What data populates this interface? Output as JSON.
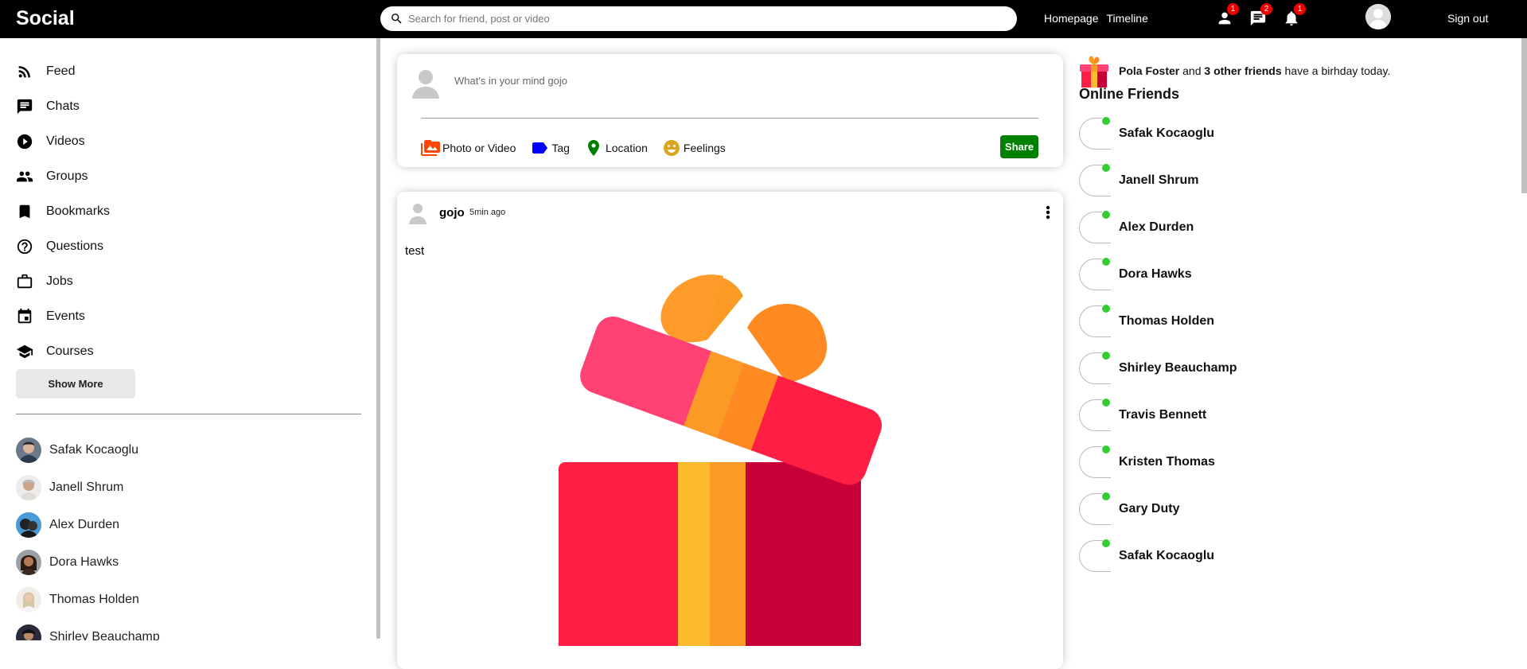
{
  "topbar": {
    "logo": "Social",
    "search_placeholder": "Search for friend, post or video",
    "links": [
      "Homepage",
      "Timeline"
    ],
    "badges": {
      "person": "1",
      "chat": "2",
      "notifications": "1"
    },
    "signout": "Sign out"
  },
  "sidebar": {
    "menu": [
      {
        "label": "Feed",
        "icon": "rss-feed-icon"
      },
      {
        "label": "Chats",
        "icon": "chat-icon"
      },
      {
        "label": "Videos",
        "icon": "play-circle-icon"
      },
      {
        "label": "Groups",
        "icon": "group-icon"
      },
      {
        "label": "Bookmarks",
        "icon": "bookmark-icon"
      },
      {
        "label": "Questions",
        "icon": "help-outline-icon"
      },
      {
        "label": "Jobs",
        "icon": "work-outline-icon"
      },
      {
        "label": "Events",
        "icon": "event-icon"
      },
      {
        "label": "Courses",
        "icon": "school-icon"
      }
    ],
    "show_more": "Show More",
    "friends": [
      "Safak Kocaoglu",
      "Janell Shrum",
      "Alex Durden",
      "Dora Hawks",
      "Thomas Holden",
      "Shirley Beauchamp"
    ]
  },
  "share": {
    "placeholder": "What's in your mind gojo",
    "options": [
      {
        "label": "Photo or Video",
        "icon": "perm-media-icon",
        "color": "#ff4500"
      },
      {
        "label": "Tag",
        "icon": "label-icon",
        "color": "#0000ff"
      },
      {
        "label": "Location",
        "icon": "room-icon",
        "color": "#008000"
      },
      {
        "label": "Feelings",
        "icon": "emoji-emotions-icon",
        "color": "#daa520"
      }
    ],
    "button": "Share"
  },
  "post": {
    "username": "gojo",
    "time": "5min ago",
    "text": "test"
  },
  "rightbar": {
    "birthday": {
      "name": "Pola Foster",
      "mid": " and ",
      "others": "3 other friends",
      "tail": " have a birhday today."
    },
    "online_title": "Online Friends",
    "online": [
      "Safak Kocaoglu",
      "Janell Shrum",
      "Alex Durden",
      "Dora Hawks",
      "Thomas Holden",
      "Shirley Beauchamp",
      "Travis Bennett",
      "Kristen Thomas",
      "Gary Duty",
      "Safak Kocaoglu"
    ]
  },
  "colors": {
    "topbar": "#000000",
    "share_button": "#008000",
    "online_dot": "#32cd32",
    "badge": "#ee0000"
  }
}
